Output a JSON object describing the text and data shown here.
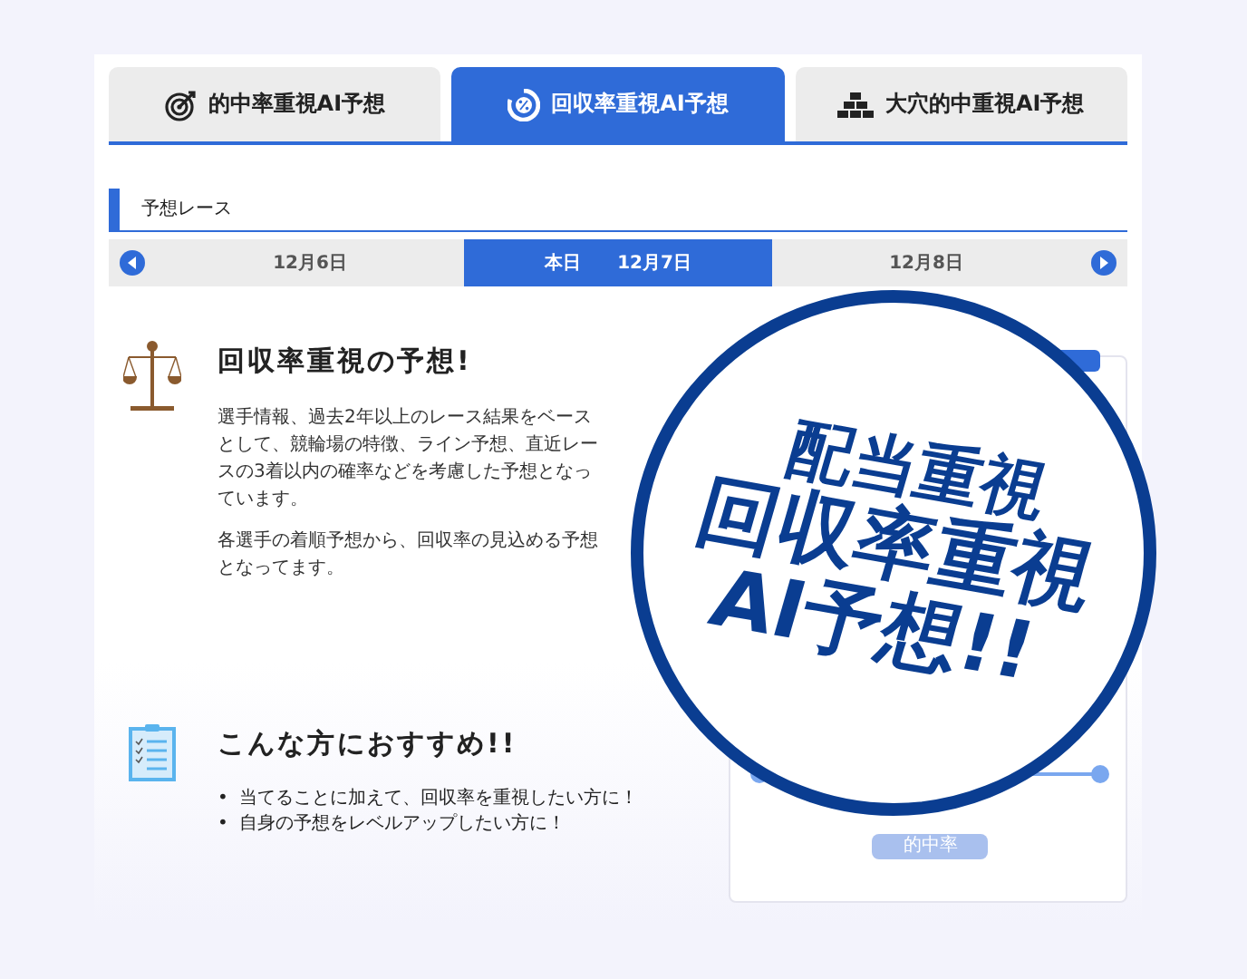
{
  "tabs": [
    {
      "label": "的中率重視AI予想",
      "selected": false
    },
    {
      "label": "回収率重視AI予想",
      "selected": true
    },
    {
      "label": "大穴的中重視AI予想",
      "selected": false
    }
  ],
  "section_title": "予想レース",
  "dates": [
    {
      "label": "12月6日",
      "selected": false
    },
    {
      "label": "本日　　12月7日",
      "selected": true
    },
    {
      "label": "12月8日",
      "selected": false
    }
  ],
  "feature": {
    "title": "回収率重視の予想!",
    "paragraphs": [
      "選手情報、過去2年以上のレース結果をベースとして、競輪場の特徴、ライン予想、直近レースの3着以内の確率などを考慮した予想となっています。",
      "各選手の着順予想から、回収率の見込める予想となってます。"
    ]
  },
  "recommend": {
    "title": "こんな方におすすめ!!",
    "bullet": "•",
    "items": [
      "当てることに加えて、回収率を重視したい方に！",
      "自身の予想をレベルアップしたい方に！"
    ]
  },
  "side_card": {
    "label": "的中率"
  },
  "stamp": {
    "lines": [
      "配当重視",
      "回収率重視",
      "AI予想!!"
    ]
  }
}
